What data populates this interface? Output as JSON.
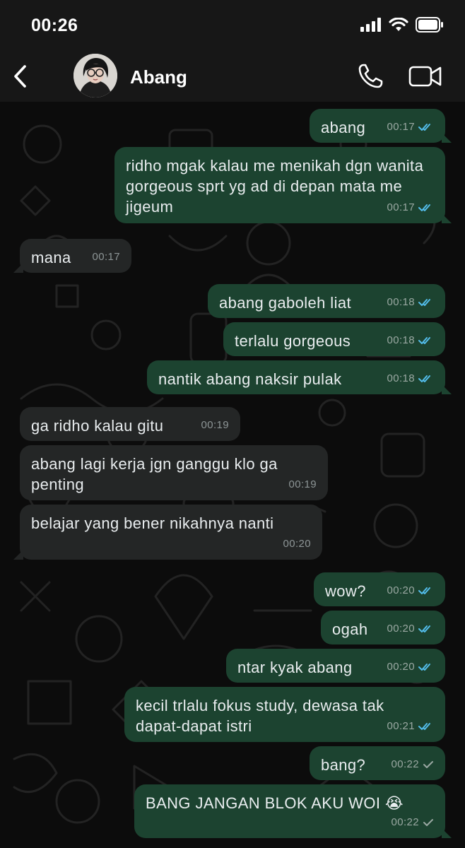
{
  "status_bar": {
    "time": "00:26",
    "icons": [
      "cellular-signal-icon",
      "wifi-icon",
      "battery-icon"
    ]
  },
  "header": {
    "back_icon": "chevron-left-icon",
    "contact_name": "Abang",
    "actions": [
      "phone-call-icon",
      "video-call-icon"
    ]
  },
  "colors": {
    "outgoing_bubble": "#1c4330",
    "incoming_bubble": "#242626",
    "read_tick": "#53bdeb",
    "sent_tick": "#9aa8a2",
    "background": "#0c0c0c"
  },
  "messages": [
    {
      "direction": "out",
      "text": "abang",
      "time": "00:17",
      "status": "read"
    },
    {
      "direction": "out",
      "text": "ridho mgak kalau me menikah dgn wanita gorgeous sprt yg ad di depan mata me jigeum",
      "time": "00:17",
      "status": "read"
    },
    {
      "direction": "in",
      "text": "mana",
      "time": "00:17"
    },
    {
      "direction": "out",
      "text": "abang gaboleh liat",
      "time": "00:18",
      "status": "read"
    },
    {
      "direction": "out",
      "text": "terlalu gorgeous",
      "time": "00:18",
      "status": "read"
    },
    {
      "direction": "out",
      "text": "nantik abang naksir pulak",
      "time": "00:18",
      "status": "read"
    },
    {
      "direction": "in",
      "text": "ga ridho kalau gitu",
      "time": "00:19"
    },
    {
      "direction": "in",
      "text": "abang lagi kerja jgn ganggu klo ga penting",
      "time": "00:19"
    },
    {
      "direction": "in",
      "text": "belajar yang bener nikahnya nanti",
      "time": "00:20"
    },
    {
      "direction": "out",
      "text": "wow?",
      "time": "00:20",
      "status": "read"
    },
    {
      "direction": "out",
      "text": "ogah",
      "time": "00:20",
      "status": "read"
    },
    {
      "direction": "out",
      "text": "ntar kyak abang",
      "time": "00:20",
      "status": "read"
    },
    {
      "direction": "out",
      "text": "kecil trlalu fokus study, dewasa tak dapat-dapat istri",
      "time": "00:21",
      "status": "read"
    },
    {
      "direction": "out",
      "text": "bang?",
      "time": "00:22",
      "status": "sent"
    },
    {
      "direction": "out",
      "text": "BANG JANGAN BLOK AKU WOI 😭",
      "time": "00:22",
      "status": "sent"
    }
  ]
}
